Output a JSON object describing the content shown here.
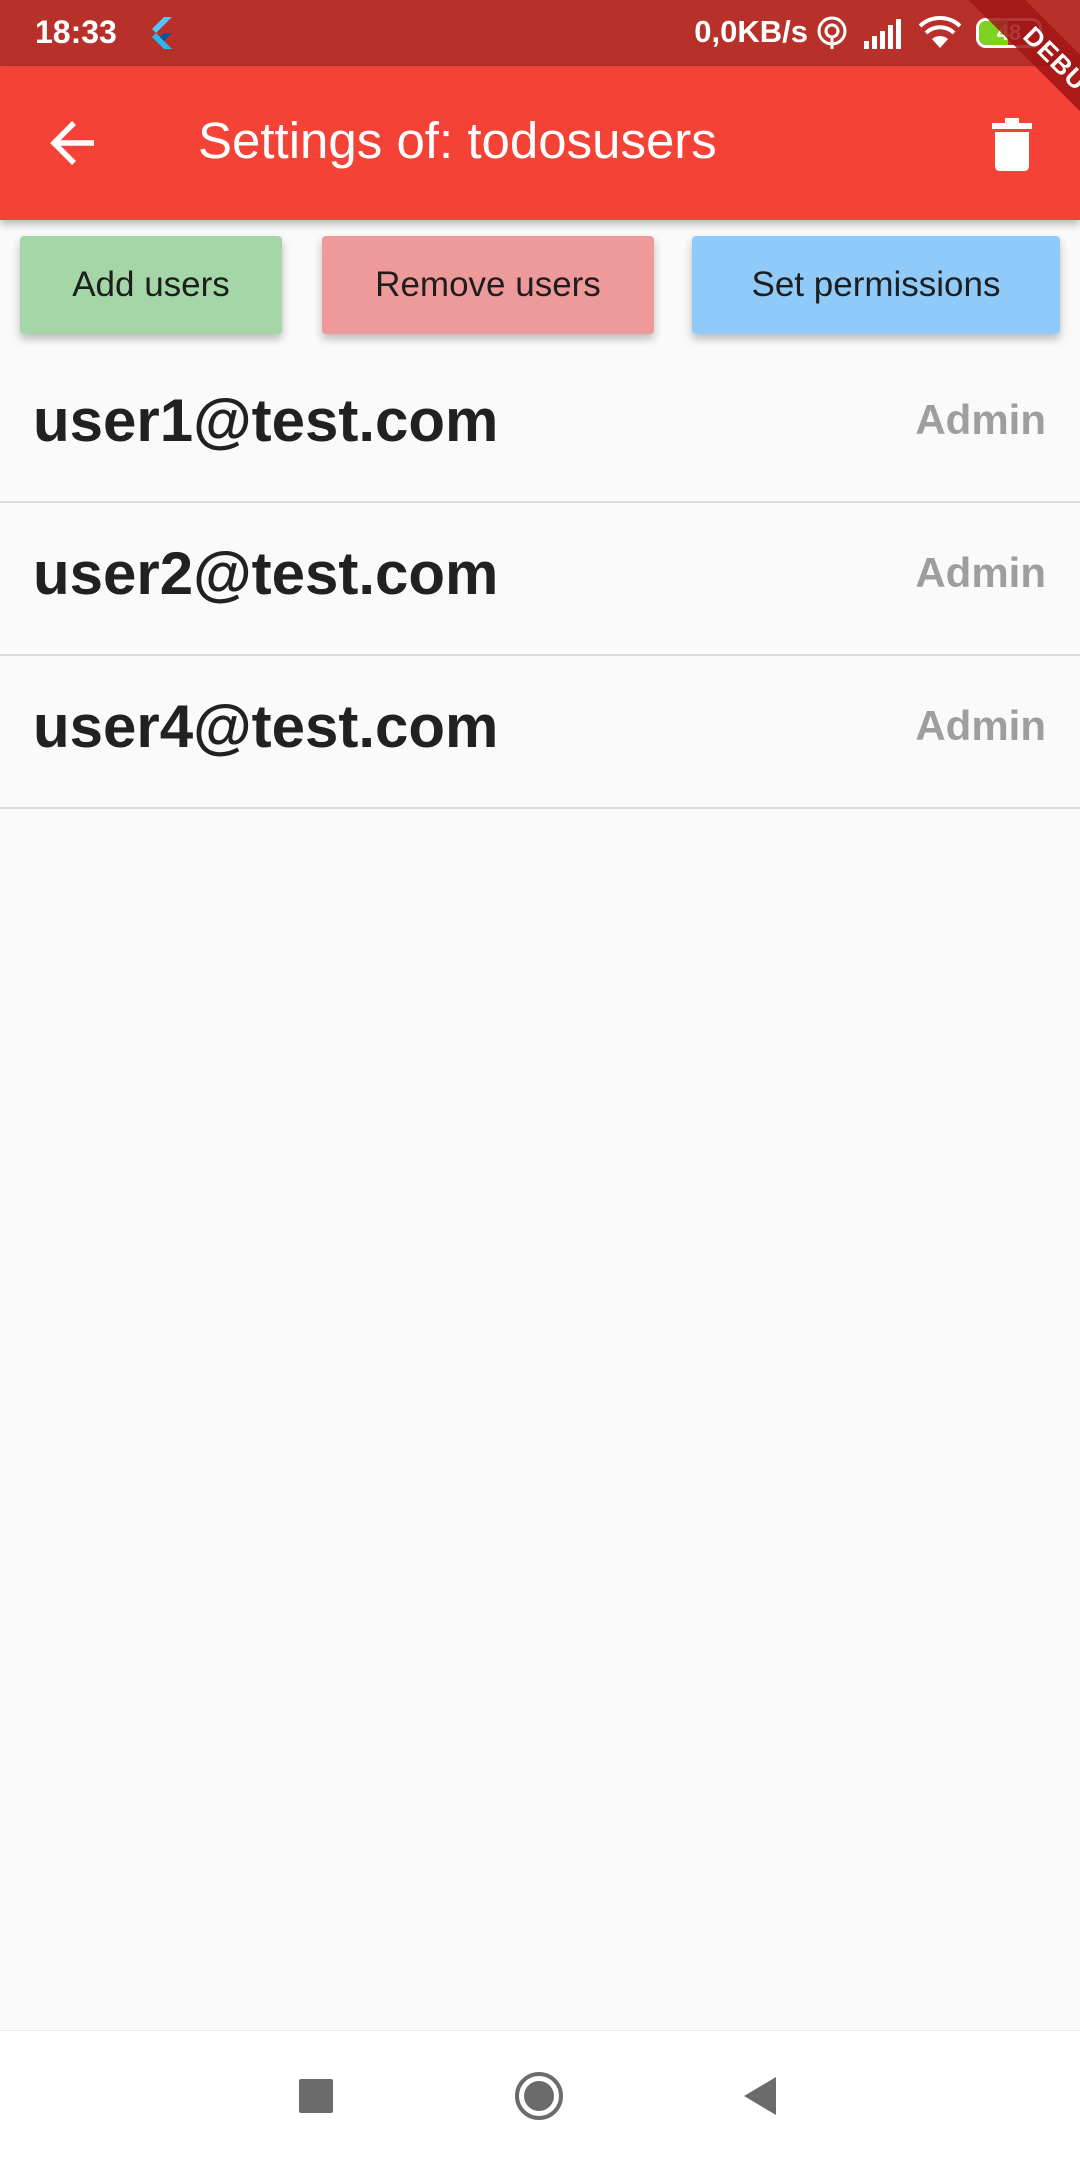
{
  "status_bar": {
    "time": "18:33",
    "net_speed": "0,0KB/s",
    "battery_level": "48",
    "battery_fraction": 0.48,
    "icons": [
      "flutter-icon",
      "hotspot-icon",
      "signal-icon",
      "wifi-icon",
      "battery-icon"
    ]
  },
  "debug_banner": "DEBUG",
  "app_bar": {
    "title": "Settings of: todosusers",
    "color": "#f44336",
    "icons": [
      "back-arrow-icon",
      "trash-icon"
    ]
  },
  "actions": {
    "add_label": "Add users",
    "remove_label": "Remove users",
    "permissions_label": "Set permissions",
    "colors": {
      "add": "#a5d6a7",
      "remove": "#ef9a9a",
      "permissions": "#90caf9"
    }
  },
  "users": [
    {
      "email": "user1@test.com",
      "role": "Admin"
    },
    {
      "email": "user2@test.com",
      "role": "Admin"
    },
    {
      "email": "user4@test.com",
      "role": "Admin"
    }
  ],
  "nav_bar": {
    "icons": [
      "recent-apps-icon",
      "home-icon",
      "back-icon"
    ]
  }
}
